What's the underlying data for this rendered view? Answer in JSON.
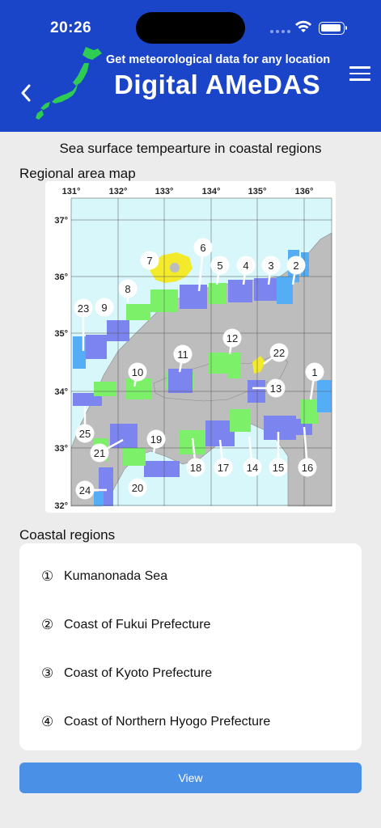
{
  "status_bar": {
    "time": "20:26"
  },
  "header": {
    "subtitle": "Get meteorological data for any location",
    "title": "Digital AMeDAS"
  },
  "page": {
    "heading": "Sea surface tempearture in coastal regions",
    "map_label": "Regional area map",
    "list_label": "Coastal regions",
    "view_button": "View"
  },
  "map": {
    "lon_labels": [
      "131°",
      "132°",
      "133°",
      "134°",
      "135°",
      "136°"
    ],
    "lat_labels": [
      "37°",
      "36°",
      "35°",
      "34°",
      "33°",
      "32°"
    ],
    "region_numbers": [
      "1",
      "2",
      "3",
      "4",
      "5",
      "6",
      "7",
      "8",
      "9",
      "10",
      "11",
      "12",
      "13",
      "14",
      "15",
      "16",
      "17",
      "18",
      "19",
      "20",
      "21",
      "22",
      "23",
      "24",
      "25"
    ],
    "colors": {
      "sea": "#d8f7fb",
      "land": "#bdbdbd",
      "blue": "#7b84ef",
      "green": "#7df06a",
      "yellow": "#f2ea2a",
      "sky": "#55aef5"
    }
  },
  "regions": [
    {
      "num": "①",
      "name": "Kumanonada Sea"
    },
    {
      "num": "②",
      "name": "Coast of Fukui Prefecture"
    },
    {
      "num": "③",
      "name": "Coast of Kyoto Prefecture"
    },
    {
      "num": "④",
      "name": "Coast of Northern Hyogo Prefecture"
    }
  ],
  "icons": {
    "back": "chevron-left-icon",
    "menu": "hamburger-menu-icon",
    "logo": "japan-map-logo-icon"
  },
  "theme": {
    "header": "#1a45c8",
    "button": "#4a90e6",
    "background": "#ececec"
  }
}
